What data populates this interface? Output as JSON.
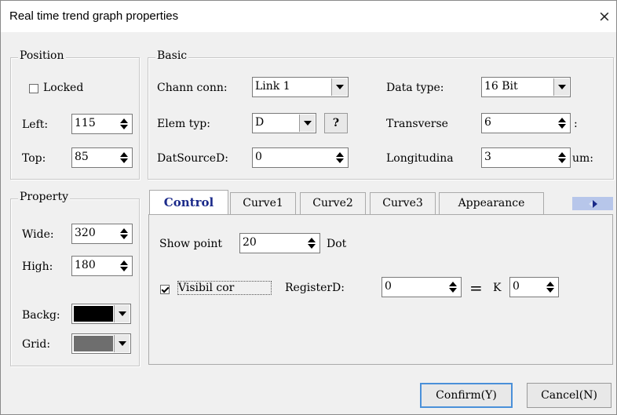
{
  "window": {
    "title": "Real time trend graph properties",
    "close_glyph": "×"
  },
  "position_group": {
    "legend": "Position",
    "locked_label": "Locked",
    "locked_checked": false,
    "left_label": "Left:",
    "left_value": "115",
    "top_label": "Top:",
    "top_value": "85"
  },
  "property_group": {
    "legend": "Property",
    "wide_label": "Wide:",
    "wide_value": "320",
    "high_label": "High:",
    "high_value": "180",
    "backg_label": "Backg:",
    "backg_color": "#000000",
    "grid_label": "Grid:",
    "grid_color": "#6e6e6e"
  },
  "basic_group": {
    "legend": "Basic",
    "chann_conn_label": "Chann conn:",
    "chann_conn_value": "Link 1",
    "data_type_label": "Data type:",
    "data_type_value": "16 Bit",
    "elem_typ_label": "Elem typ:",
    "elem_typ_value": "D",
    "help_button": "?",
    "transverse_label": "Transverse",
    "transverse_value": "6",
    "transverse_suffix": ":",
    "datsource_label": "DatSourceD:",
    "datsource_value": "0",
    "longitudinal_label": "Longitudina",
    "longitudinal_value": "3",
    "longitudinal_suffix": "um:"
  },
  "tabs": [
    {
      "label": "Control",
      "active": true
    },
    {
      "label": "Curve1",
      "active": false
    },
    {
      "label": "Curve2",
      "active": false
    },
    {
      "label": "Curve3",
      "active": false
    },
    {
      "label": "Appearance",
      "active": false
    }
  ],
  "control_tab": {
    "show_point_label": "Show point",
    "show_point_value": "20",
    "dot_label": "Dot",
    "visibil_label": "Visibil cor",
    "visibil_checked": true,
    "registerd_label": "RegisterD:",
    "registerd_value": "0",
    "equals": "=",
    "k_label": "K",
    "k_value": "0"
  },
  "buttons": {
    "confirm": "Confirm(Y)",
    "cancel": "Cancel(N)"
  },
  "colors": {
    "accent_tab_text": "#1b2a8a",
    "default_button_border": "#4a90d9"
  }
}
